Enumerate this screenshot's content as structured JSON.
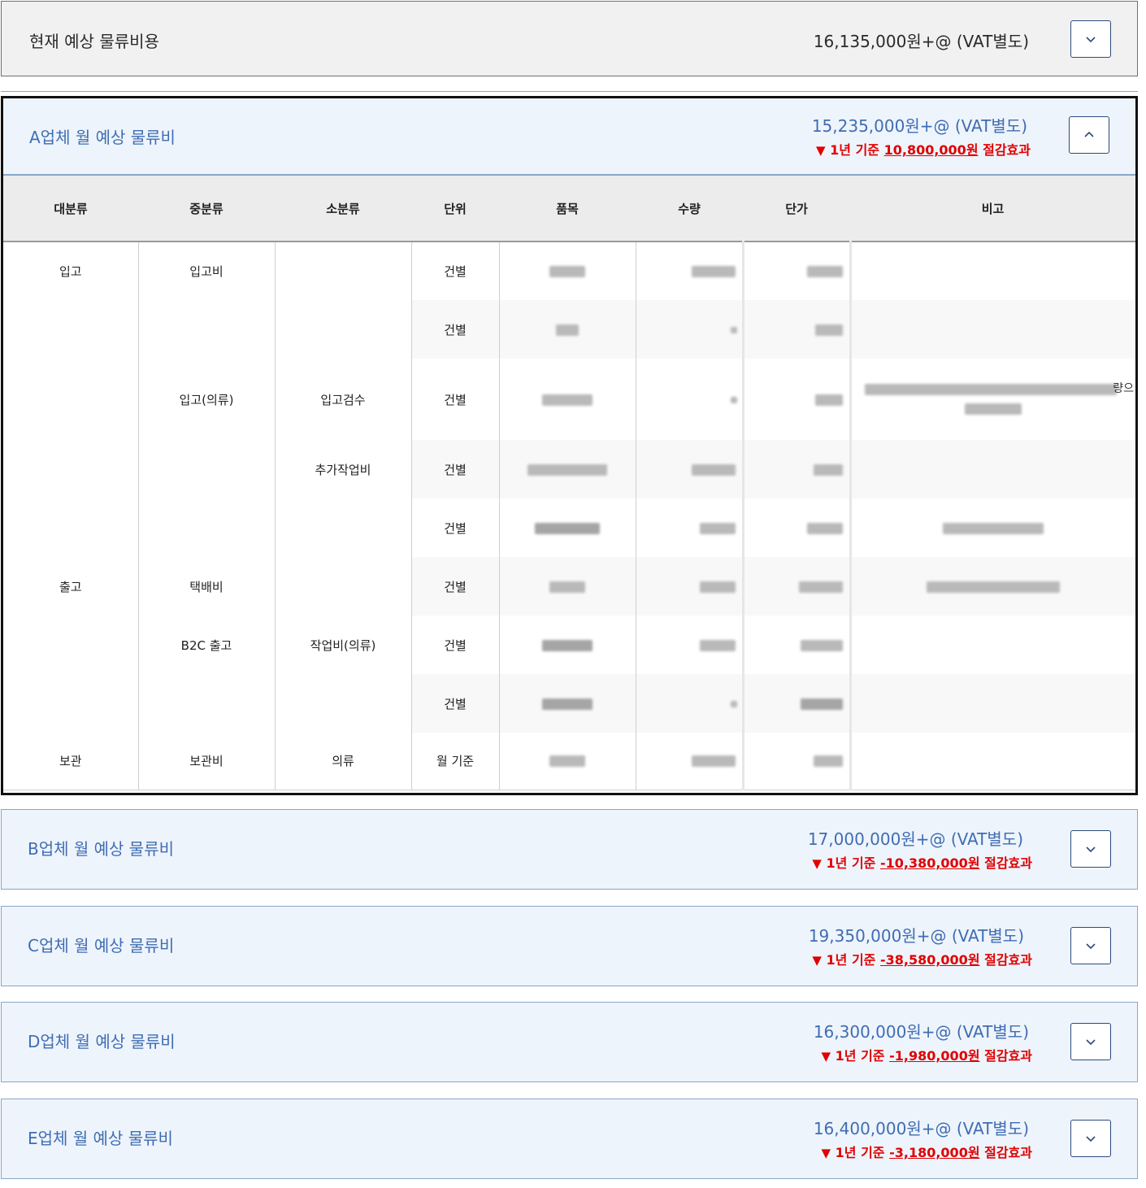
{
  "current": {
    "title": "현재 예상 물류비용",
    "amount": "16,135,000원+@ (VAT별도)"
  },
  "vendor_a": {
    "title": "A업체 월 예상 물류비",
    "amount": "15,235,000원+@ (VAT별도)",
    "save_prefix": "1년 기준 ",
    "save_value": "10,800,000원",
    "save_suffix": " 절감효과",
    "table": {
      "headers": [
        "대분류",
        "중분류",
        "소분류",
        "단위",
        "품목",
        "수량",
        "단가",
        "비고"
      ],
      "rows": [
        {
          "major": "입고",
          "mid": "입고비",
          "minor": "",
          "unit": "건별"
        },
        {
          "major": "",
          "mid": "",
          "minor": "",
          "unit": "건별"
        },
        {
          "major": "",
          "mid": "입고(의류)",
          "minor": "입고검수",
          "unit": "건별",
          "note_tail": "량으"
        },
        {
          "major": "",
          "mid": "",
          "minor": "추가작업비",
          "unit": "건별"
        },
        {
          "major": "",
          "mid": "",
          "minor": "",
          "unit": "건별"
        },
        {
          "major": "출고",
          "mid": "택배비",
          "minor": "",
          "unit": "건별"
        },
        {
          "major": "",
          "mid": "B2C 출고",
          "minor": "작업비(의류)",
          "unit": "건별"
        },
        {
          "major": "",
          "mid": "",
          "minor": "",
          "unit": "건별"
        },
        {
          "major": "보관",
          "mid": "보관비",
          "minor": "의류",
          "unit": "월 기준"
        }
      ]
    }
  },
  "vendors": [
    {
      "title": "B업체 월 예상 물류비",
      "amount": "17,000,000원+@ (VAT별도)",
      "save_prefix": "1년 기준 ",
      "save_value": "-10,380,000원",
      "save_suffix": " 절감효과"
    },
    {
      "title": "C업체 월 예상 물류비",
      "amount": "19,350,000원+@ (VAT별도)",
      "save_prefix": "1년 기준 ",
      "save_value": "-38,580,000원",
      "save_suffix": " 절감효과"
    },
    {
      "title": "D업체 월 예상 물류비",
      "amount": "16,300,000원+@ (VAT별도)",
      "save_prefix": "1년 기준 ",
      "save_value": "-1,980,000원",
      "save_suffix": " 절감효과"
    },
    {
      "title": "E업체 월 예상 물류비",
      "amount": "16,400,000원+@ (VAT별도)",
      "save_prefix": "1년 기준 ",
      "save_value": "-3,180,000원",
      "save_suffix": " 절감효과"
    }
  ],
  "icons": {
    "collapsed": "chevron-down-icon",
    "expanded": "chevron-up-icon",
    "savings": "triangle-down-icon"
  },
  "colors": {
    "accent": "#3f6db2",
    "savings": "#e00000",
    "panel_bg": "#eef4fc",
    "border": "#8aa5c8"
  }
}
